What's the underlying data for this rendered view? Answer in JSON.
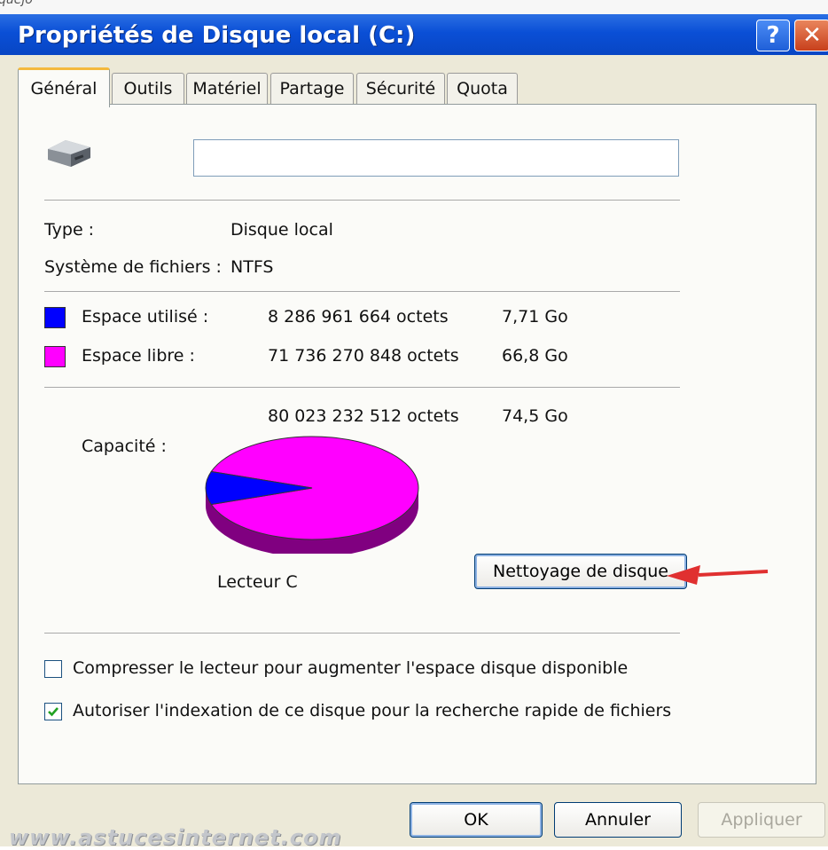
{
  "topstrip_text": "quejo",
  "window": {
    "title": "Propriétés de Disque local (C:)",
    "help_label": "?",
    "close_label": "✕"
  },
  "tabs": [
    {
      "label": "Général",
      "active": true
    },
    {
      "label": "Outils",
      "active": false
    },
    {
      "label": "Matériel",
      "active": false
    },
    {
      "label": "Partage",
      "active": false
    },
    {
      "label": "Sécurité",
      "active": false
    },
    {
      "label": "Quota",
      "active": false
    }
  ],
  "general": {
    "drive_icon": "hard-drive-icon",
    "volume_name": "",
    "type_label": "Type :",
    "type_value": "Disque local",
    "fs_label": "Système de fichiers :",
    "fs_value": "NTFS",
    "used": {
      "label": "Espace utilisé :",
      "bytes": "8 286 961 664 octets",
      "size": "7,71 Go",
      "color": "#0000ff"
    },
    "free": {
      "label": "Espace libre :",
      "bytes": "71 736 270 848 octets",
      "size": "66,8 Go",
      "color": "#ff00ff"
    },
    "capacity": {
      "label": "Capacité :",
      "bytes": "80 023 232 512 octets",
      "size": "74,5 Go"
    },
    "drive_caption": "Lecteur C",
    "cleanup_button": "Nettoyage de disque",
    "compress_label": "Compresser le lecteur pour augmenter l'espace disque disponible",
    "compress_checked": false,
    "index_label": "Autoriser l'indexation de ce disque pour la recherche rapide de fichiers",
    "index_checked": true
  },
  "pie": {
    "used_fraction": 0.1036,
    "free_fraction": 0.8964
  },
  "buttons": {
    "ok": "OK",
    "cancel": "Annuler",
    "apply": "Appliquer"
  },
  "annotation": {
    "arrow_color": "#e03030"
  },
  "watermark": "www.astucesinternet.com"
}
